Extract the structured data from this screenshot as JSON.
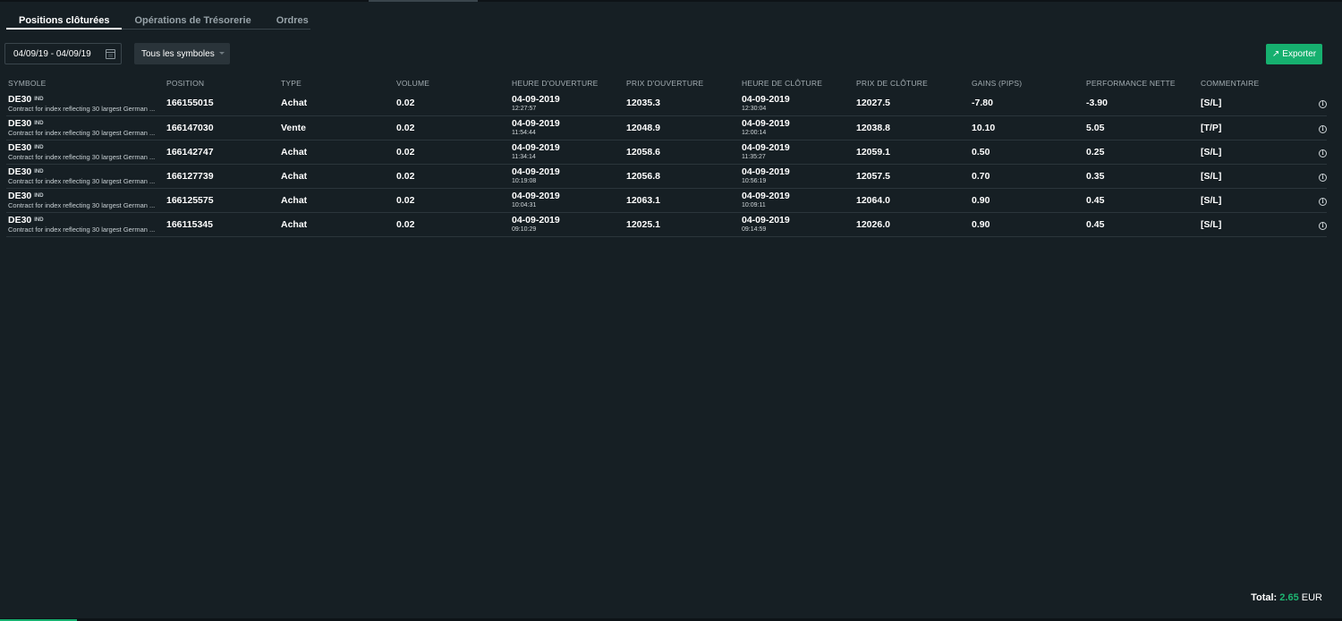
{
  "tabs": [
    {
      "label": "Positions clôturées",
      "active": true
    },
    {
      "label": "Opérations de Trésorerie",
      "active": false
    },
    {
      "label": "Ordres",
      "active": false
    }
  ],
  "filters": {
    "date_range": "04/09/19 - 04/09/19",
    "symbol_select": "Tous les symboles"
  },
  "export_label": "Exporter",
  "columns": {
    "symbol": "SYMBOLE",
    "position": "POSITION",
    "type": "TYPE",
    "volume": "VOLUME",
    "open_time": "HEURE D'OUVERTURE",
    "open_price": "PRIX D'OUVERTURE",
    "close_time": "HEURE DE CLÔTURE",
    "close_price": "PRIX DE CLÔTURE",
    "gains": "GAINS (PIPS)",
    "performance": "PERFORMANCE NETTE",
    "comment": "COMMENTAIRE"
  },
  "rows": [
    {
      "symbol": "DE30",
      "tag": "IND",
      "desc": "Contract for index reflecting 30 largest German ...",
      "position": "166155015",
      "type": "Achat",
      "volume": "0.02",
      "open_date": "04-09-2019",
      "open_time": "12:27:57",
      "open_price": "12035.3",
      "close_date": "04-09-2019",
      "close_time": "12:30:04",
      "close_price": "12027.5",
      "gains": "-7.80",
      "performance": "-3.90",
      "perf_sign": "neg",
      "comment": "[S/L]"
    },
    {
      "symbol": "DE30",
      "tag": "IND",
      "desc": "Contract for index reflecting 30 largest German ...",
      "position": "166147030",
      "type": "Vente",
      "volume": "0.02",
      "open_date": "04-09-2019",
      "open_time": "11:54:44",
      "open_price": "12048.9",
      "close_date": "04-09-2019",
      "close_time": "12:00:14",
      "close_price": "12038.8",
      "gains": "10.10",
      "performance": "5.05",
      "perf_sign": "pos",
      "comment": "[T/P]"
    },
    {
      "symbol": "DE30",
      "tag": "IND",
      "desc": "Contract for index reflecting 30 largest German ...",
      "position": "166142747",
      "type": "Achat",
      "volume": "0.02",
      "open_date": "04-09-2019",
      "open_time": "11:34:14",
      "open_price": "12058.6",
      "close_date": "04-09-2019",
      "close_time": "11:35:27",
      "close_price": "12059.1",
      "gains": "0.50",
      "performance": "0.25",
      "perf_sign": "pos",
      "comment": "[S/L]"
    },
    {
      "symbol": "DE30",
      "tag": "IND",
      "desc": "Contract for index reflecting 30 largest German ...",
      "position": "166127739",
      "type": "Achat",
      "volume": "0.02",
      "open_date": "04-09-2019",
      "open_time": "10:19:08",
      "open_price": "12056.8",
      "close_date": "04-09-2019",
      "close_time": "10:56:19",
      "close_price": "12057.5",
      "gains": "0.70",
      "performance": "0.35",
      "perf_sign": "pos",
      "comment": "[S/L]"
    },
    {
      "symbol": "DE30",
      "tag": "IND",
      "desc": "Contract for index reflecting 30 largest German ...",
      "position": "166125575",
      "type": "Achat",
      "volume": "0.02",
      "open_date": "04-09-2019",
      "open_time": "10:04:31",
      "open_price": "12063.1",
      "close_date": "04-09-2019",
      "close_time": "10:09:11",
      "close_price": "12064.0",
      "gains": "0.90",
      "performance": "0.45",
      "perf_sign": "pos",
      "comment": "[S/L]"
    },
    {
      "symbol": "DE30",
      "tag": "IND",
      "desc": "Contract for index reflecting 30 largest German ...",
      "position": "166115345",
      "type": "Achat",
      "volume": "0.02",
      "open_date": "04-09-2019",
      "open_time": "09:10:29",
      "open_price": "12025.1",
      "close_date": "04-09-2019",
      "close_time": "09:14:59",
      "close_price": "12026.0",
      "gains": "0.90",
      "performance": "0.45",
      "perf_sign": "pos",
      "comment": "[S/L]"
    }
  ],
  "total": {
    "label": "Total:",
    "value": "2.65",
    "currency": "EUR"
  },
  "icons": {
    "calendar": "calendar-icon",
    "export": "share-export-icon",
    "info": "info-icon",
    "select": "chevron-down-icon"
  },
  "colors": {
    "background": "#161f24",
    "accent": "#16b06f",
    "positive": "#1eb672",
    "negative": "#d0414a"
  }
}
